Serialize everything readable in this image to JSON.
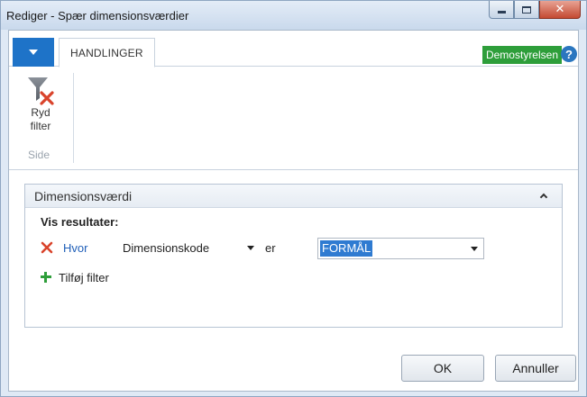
{
  "window": {
    "title": "Rediger - Spær dimensionsværdier"
  },
  "ribbon": {
    "tabs": [
      {
        "label": "HANDLINGER"
      }
    ],
    "company_badge": "Demostyrelsen",
    "groups": [
      {
        "label": "Side",
        "buttons": [
          {
            "label_line1": "Ryd",
            "label_line2": "filter",
            "icon": "clear-filter-icon"
          }
        ]
      }
    ]
  },
  "panel": {
    "title": "Dimensionsværdi",
    "show_results_label": "Vis resultater:",
    "filter": {
      "where_label": "Hvor",
      "field": "Dimensionskode",
      "operator": "er",
      "value": "FORMÅL"
    },
    "add_filter_label": "Tilføj filter"
  },
  "buttons": {
    "ok": "OK",
    "cancel": "Annuller"
  },
  "colors": {
    "accent_blue": "#1e73c8",
    "company_green": "#2e9e3a",
    "remove_red": "#d9432b",
    "link_blue": "#1f5fb8",
    "selection_blue": "#2f7bd1"
  }
}
